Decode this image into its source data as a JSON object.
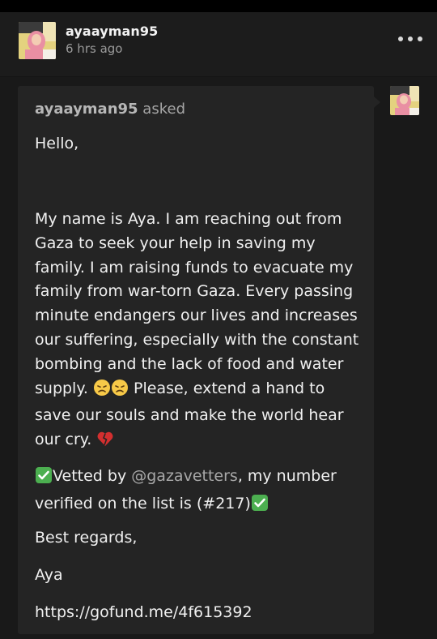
{
  "post": {
    "username": "ayaayman95",
    "timestamp": "6 hrs ago"
  },
  "ask": {
    "asker": "ayaayman95",
    "asked_label": " asked",
    "greeting": "Hello,",
    "message_part1": "My name is Aya. I am reaching out from Gaza to seek your help in saving my family. I am raising funds to evacuate my family from war-torn Gaza. Every passing minute endangers our lives and increases our suffering, especially with the constant bombing and the lack of food and water supply.",
    "message_part2": "Please, extend a hand to save our souls and make the world hear our cry.",
    "vetted_prefix": "Vetted by ",
    "vetted_mention": "@gazavetters",
    "vetted_suffix": ", my number verified on the list is (#217)",
    "regards": "Best regards,",
    "signature": "Aya",
    "link": "https://gofund.me/4f615392"
  },
  "icons": {
    "more": "more-options-icon",
    "disappointed": "disappointed-face-emoji",
    "broken_heart": "broken-heart-emoji",
    "check": "check-mark-button-emoji"
  },
  "colors": {
    "background": "#191919",
    "card": "#242424",
    "check_green": "#4caf50",
    "broken_heart": "#d32f2f"
  }
}
